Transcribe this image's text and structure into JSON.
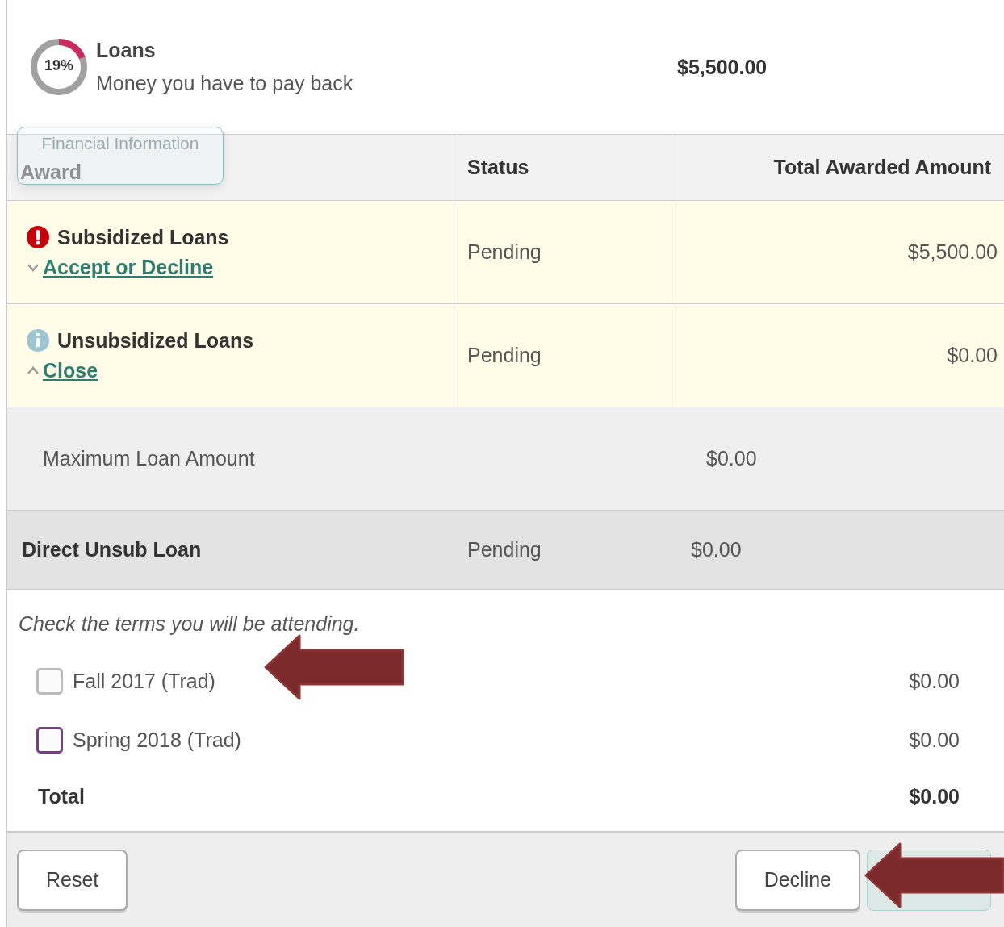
{
  "summary": {
    "percent": "19%",
    "title": "Loans",
    "subtitle": "Money you have to pay back",
    "amount": "$5,500.00"
  },
  "tooltip": {
    "text": "Financial Information"
  },
  "table": {
    "columns": [
      "Award",
      "Status",
      "Total Awarded Amount"
    ],
    "rows": [
      {
        "name": "Subsidized Loans",
        "kind": "alert",
        "link": "Accept or Decline",
        "expanded": false,
        "status": "Pending",
        "amount": "$5,500.00"
      },
      {
        "name": "Unsubsidized Loans",
        "kind": "info",
        "link": "Close",
        "expanded": true,
        "status": "Pending",
        "amount": "$0.00"
      }
    ]
  },
  "max_loan": {
    "label": "Maximum Loan Amount",
    "amount": "$0.00"
  },
  "loan": {
    "name": "Direct Unsub Loan",
    "status": "Pending",
    "amount": "$0.00"
  },
  "terms": {
    "instruction": "Check the terms you will be attending.",
    "items": [
      {
        "label": "Fall 2017 (Trad)",
        "checked": false,
        "color": "#bbbbbb",
        "amount": "$0.00"
      },
      {
        "label": "Spring 2018 (Trad)",
        "checked": false,
        "color": "#7b3a8e",
        "amount": "$0.00"
      }
    ],
    "total_label": "Total",
    "total": "$0.00"
  },
  "buttons": [
    {
      "label": "Reset",
      "kind": "plain"
    },
    {
      "label": "Decline",
      "kind": "plain"
    },
    {
      "kind": "primary"
    }
  ]
}
